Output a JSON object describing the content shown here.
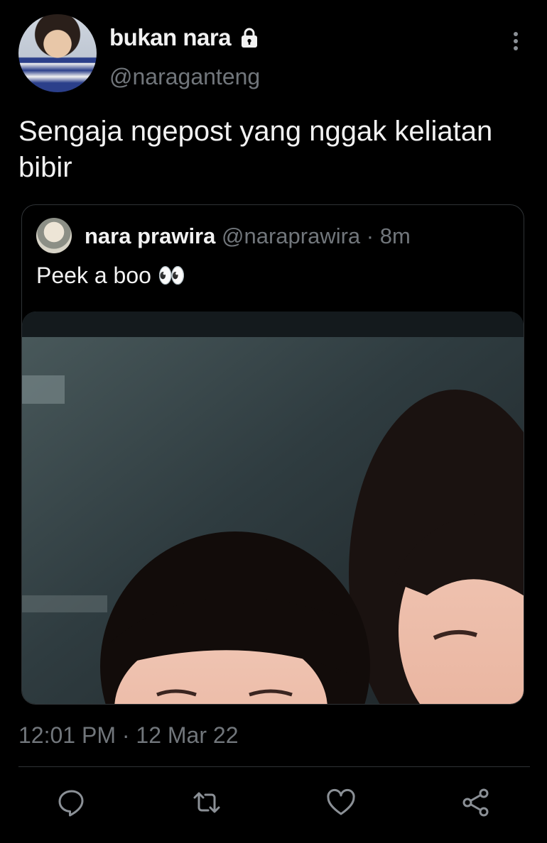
{
  "author": {
    "display_name": "bukan nara",
    "handle": "@naraganteng",
    "protected_icon": "lock-icon"
  },
  "tweet": {
    "text": "Sengaja ngepost yang nggak keliatan bibir",
    "timestamp": "12:01 PM · 12 Mar 22"
  },
  "quoted_tweet": {
    "display_name": "nara prawira",
    "meta": "@naraprawira · 8m",
    "text": "Peek a boo 👀",
    "media_description": "selfie-photo"
  },
  "actions": [
    {
      "icon": "reply-icon"
    },
    {
      "icon": "retweet-icon"
    },
    {
      "icon": "like-icon"
    },
    {
      "icon": "share-icon"
    }
  ],
  "colors": {
    "background": "#000000",
    "text_primary": "#f2f2f2",
    "text_secondary": "#71767b",
    "border": "#2f3336"
  }
}
